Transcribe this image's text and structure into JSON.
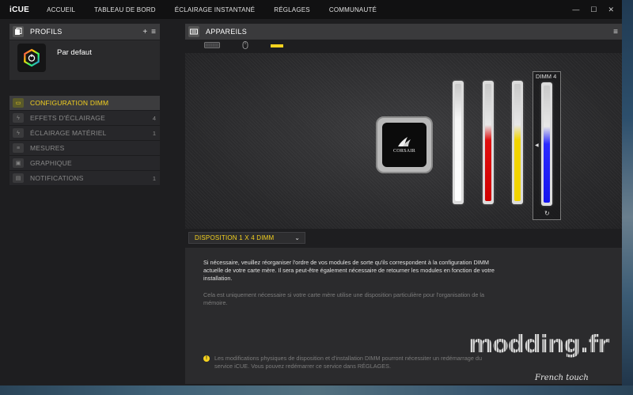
{
  "titlebar": {
    "app_name": "iCUE",
    "nav": [
      "ACCUEIL",
      "TABLEAU DE BORD",
      "ÉCLAIRAGE INSTANTANÉ",
      "RÉGLAGES",
      "COMMUNAUTÉ"
    ],
    "window_controls": {
      "minimize": "—",
      "maximize": "☐",
      "close": "✕"
    }
  },
  "profiles": {
    "title": "PROFILS",
    "add_icon": "+",
    "menu_icon": "≡",
    "current_profile": "Par defaut"
  },
  "menu": {
    "items": [
      {
        "label": "CONFIGURATION DIMM",
        "count": "",
        "icon": "dimm-icon",
        "active": true
      },
      {
        "label": "EFFETS D'ÉCLAIRAGE",
        "count": "4",
        "icon": "lightning-icon",
        "active": false
      },
      {
        "label": "ÉCLAIRAGE MATÉRIEL",
        "count": "1",
        "icon": "lightning-icon",
        "active": false
      },
      {
        "label": "MESURES",
        "count": "",
        "icon": "gauge-icon",
        "active": false
      },
      {
        "label": "GRAPHIQUE",
        "count": "",
        "icon": "image-icon",
        "active": false
      },
      {
        "label": "NOTIFICATIONS",
        "count": "1",
        "icon": "chat-icon",
        "active": false
      }
    ]
  },
  "devices": {
    "title": "APPAREILS",
    "tabs": [
      "keyboard-icon",
      "mouse-icon",
      "memory-icon"
    ]
  },
  "stage": {
    "cooler_brand": "CORSAIR",
    "selected_dimm_label": "DIMM 4",
    "dimm_colors": [
      "#f2f2f2",
      "#e01010",
      "#f2d400",
      "#1a1aff"
    ]
  },
  "layout": {
    "selected": "DISPOSITION 1 X 4 DIMM"
  },
  "info": {
    "paragraph1": "Si nécessaire, veuillez réorganiser l'ordre de vos modules de sorte qu'ils correspondent à la configuration DIMM actuelle de votre carte mère. Il sera peut-être également nécessaire de retourner les modules en fonction de votre installation.",
    "paragraph2": "Cela est uniquement nécessaire si votre carte mère utilise une disposition particulière pour l'organisation de la mémoire.",
    "note": "Les modifications physiques de disposition et d'installation DIMM pourront nécessiter un redémarrage du service iCUE. Vous pouvez redémarrer ce service dans RÉGLAGES."
  },
  "watermark": {
    "main": "modding.fr",
    "sub": "French touch"
  },
  "colors": {
    "accent": "#f5d21f",
    "background": "#1e1e20"
  }
}
